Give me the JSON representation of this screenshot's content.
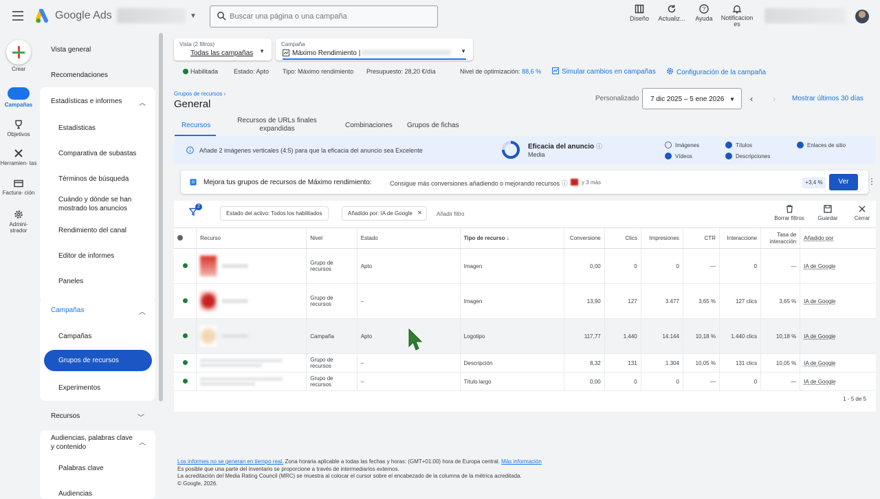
{
  "topbar": {
    "brand": "Google Ads",
    "search_placeholder": "Buscar una página o una campaña",
    "tools": [
      "Diseño",
      "Actualiz...",
      "Ayuda",
      "Notificacion es"
    ]
  },
  "rail": {
    "create": "Crear",
    "items": [
      "Campañas",
      "Objetivos",
      "Herramien- tas",
      "Factura- ción",
      "Admini- strador"
    ]
  },
  "sidenav": {
    "vista_general": "Vista general",
    "recomendaciones": "Recomendaciones",
    "estadisticas_group": "Estadísticas e informes",
    "estadisticas_items": [
      "Estadísticas",
      "Comparativa de subastas",
      "Términos de búsqueda",
      "Cuándo y dónde se han mostrado los anuncios",
      "Rendimiento del canal",
      "Editor de informes",
      "Paneles"
    ],
    "campanas_group": "Campañas",
    "campanas_items": [
      "Campañas",
      "Grupos de recursos",
      "Experimentos"
    ],
    "recursos": "Recursos",
    "audiencias": "Audiencias, palabras clave y contenido",
    "audiencias_items": [
      "Palabras clave",
      "Audiencias"
    ]
  },
  "filters": {
    "vista_label": "Vista (2 filtros)",
    "vista_value": "Todas las campañas",
    "campana_label": "Campaña",
    "campana_value": "Máximo Rendimiento |"
  },
  "status": {
    "enabled": "Habilitada",
    "estado": "Estado: Apto",
    "tipo": "Tipo: Máximo rendimiento",
    "presupuesto": "Presupuesto: 28,20 €/día",
    "optim_label": "Nivel de optimización:",
    "optim_value": "88,6 %",
    "simular": "Simular cambios en campañas",
    "config": "Configuración de la campaña"
  },
  "page": {
    "breadcrumb": "Grupos de recursos ›",
    "title": "General",
    "date_label": "Personalizado",
    "date_range": "7 dic 2025 – 5 ene 2026",
    "show_last": "Mostrar últimos 30 días"
  },
  "tabs": [
    "Recursos",
    "Recursos de URLs finales expandidas",
    "Combinaciones",
    "Grupos de fichas"
  ],
  "banner": {
    "text": "Añade 2 imágenes verticales (4:5) para que la eficacia del anuncio sea Excelente",
    "eff_title": "Eficacia del anuncio",
    "eff_value": "Media",
    "checks": [
      {
        "label": "Imágenes",
        "on": false
      },
      {
        "label": "Títulos",
        "on": true
      },
      {
        "label": "Enlaces de sitio",
        "on": true
      },
      {
        "label": "Vídeos",
        "on": true
      },
      {
        "label": "Descripciones",
        "on": true
      }
    ]
  },
  "optimize": {
    "title": "Mejora tus grupos de recursos de Máximo rendimiento:",
    "sub": "Consigue más conversiones añadiendo o mejorando recursos",
    "meta": "y 3 más",
    "uplift": "+3,4 %",
    "button": "Ver"
  },
  "toolbar": {
    "chip1": "Estado del activo: Todos los habilitados",
    "chip2": "Añadido por: IA de Google",
    "add_filter": "Añadir filtro",
    "filter_count": "2",
    "buttons": [
      "Borrar filtros",
      "Guardar",
      "Cerrar"
    ]
  },
  "table": {
    "headers": [
      "Recurso",
      "Nivel",
      "Estado",
      "Tipo de recurso",
      "Conversione",
      "Clics",
      "Impresiones",
      "CTR",
      "Interaccione",
      "Tasa de interacción",
      "Añadido por"
    ],
    "rows": [
      {
        "nivel": "Grupo de recursos",
        "estado": "Apto",
        "tipo": "Imagen",
        "conv": "0,00",
        "clics": "0",
        "impr": "0",
        "ctr": "—",
        "inter": "0",
        "tasa": "—",
        "added": "IA de Google"
      },
      {
        "nivel": "Grupo de recursos",
        "estado": "–",
        "tipo": "Imagen",
        "conv": "13,90",
        "clics": "127",
        "impr": "3.477",
        "ctr": "3,65 %",
        "inter": "127 clics",
        "tasa": "3,65 %",
        "added": "IA de Google"
      },
      {
        "nivel": "Campaña",
        "estado": "Apto",
        "tipo": "Logotipo",
        "conv": "117,77",
        "clics": "1.440",
        "impr": "14.144",
        "ctr": "10,18 %",
        "inter": "1.440 clics",
        "tasa": "10,18 %",
        "added": "IA de Google"
      },
      {
        "nivel": "Grupo de recursos",
        "estado": "–",
        "tipo": "Descripción",
        "conv": "8,32",
        "clics": "131",
        "impr": "1.304",
        "ctr": "10,05 %",
        "inter": "131 clics",
        "tasa": "10,05 %",
        "added": "IA de Google"
      },
      {
        "nivel": "Grupo de recursos",
        "estado": "–",
        "tipo": "Título largo",
        "conv": "0,00",
        "clics": "0",
        "impr": "0",
        "ctr": "—",
        "inter": "0",
        "tasa": "—",
        "added": "IA de Google"
      }
    ],
    "pager": "1 - 5 de 5"
  },
  "footer": {
    "realtime": "Los informes no se generan en tiempo real.",
    "tz": " Zona horaria aplicable a todas las fechas y horas: (GMT+01:00) hora de Europa central. ",
    "more": "Más información",
    "line2": "Es posible que una parte del inventario se proporcione a través de intermediarios externos.",
    "line3": "La acreditación del Media Rating Council (MRC) se muestra al colocar el cursor sobre el encabezado de la columna de la métrica acreditada.",
    "copyright": "© Google, 2026."
  }
}
